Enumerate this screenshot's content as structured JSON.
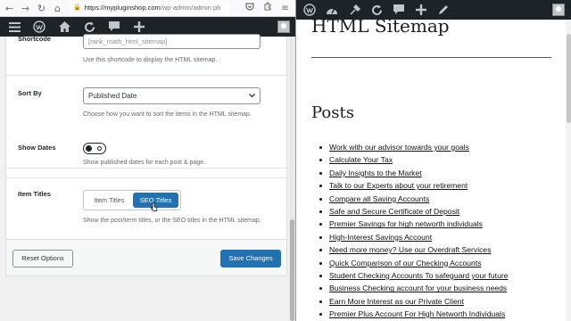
{
  "browser": {
    "url_host": "https://myplugin​shop.com",
    "url_path": "/wp-admin/admin.ph",
    "back_icon": "arrow-left-icon",
    "forward_icon": "arrow-right-icon",
    "reload_icon": "reload-icon",
    "home_icon": "home-icon",
    "pocket_icon": "pocket-icon",
    "extensions_icon": "extensions-icon",
    "menu_icon": "menu-icon"
  },
  "admin_bar": {
    "icons": [
      "menu-icon",
      "wordpress-icon",
      "home-icon",
      "updates-icon",
      "comments-icon",
      "new-content-icon"
    ]
  },
  "settings": {
    "shortcode": {
      "label": "Shortcode",
      "value": "[rank_math_html_sitemap]",
      "description": "Use this shortcode to display the HTML sitemap."
    },
    "sort_by": {
      "label": "Sort By",
      "selected": "Published Date",
      "description": "Choose how you want to sort the items in the HTML sitemap."
    },
    "show_dates": {
      "label": "Show Dates",
      "enabled": false,
      "description": "Show published dates for each post & page."
    },
    "item_titles": {
      "label": "Item Titles",
      "options": [
        "Item Titles",
        "SEO Titles"
      ],
      "selected": "SEO Titles",
      "description": "Show the post/term titles, or the SEO titles in the HTML sitemap."
    }
  },
  "footer": {
    "reset_label": "Reset Options",
    "save_label": "Save Changes"
  },
  "site": {
    "admin_icons": [
      "wordpress-icon",
      "dashboard-icon",
      "customize-icon",
      "updates-icon",
      "comments-icon",
      "new-content-icon",
      "edit-icon"
    ],
    "page_title": "HTML Sitemap",
    "posts_heading": "Posts",
    "posts": [
      "Work with our advisor towards your goals",
      "Calculate Your Tax",
      "Daily Insights to the Market",
      "Talk to our Experts about your retirement",
      "Compare all Saving Accounts",
      "Safe and Secure Certificate of Deposit",
      "Premier Savings for high networth individuals",
      "High-Interest Savings Account",
      "Need more money? Use our Overdraft Services",
      "Quick Comparison of our Checking Accounts",
      "Student Checking Accounts To safeguard your future",
      "Business Checking account for your business needs",
      "Earn More Interest as our Private Client",
      "Premier Plus Account For High Networth Individuals"
    ]
  },
  "colors": {
    "admin_bar": "#1d2327",
    "primary": "#2271b1"
  }
}
